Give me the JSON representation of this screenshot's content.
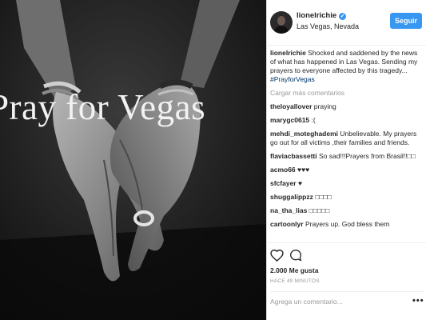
{
  "post": {
    "photo_caption": "Pray for Vegas",
    "username": "lionelrichie",
    "verified_mark": "✓",
    "location": "Las Vegas, Nevada",
    "follow_label": "Seguir",
    "caption_user": "lionelrichie",
    "caption_text": " Shocked and saddened by the news of what has happened in Las Vegas. Sending my prayers to everyone affected by this tragedy... ",
    "caption_hashtag": "#PrayforVegas",
    "load_more": "Cargar más comentarios",
    "comments": [
      {
        "user": "theloyallover",
        "text": " praying"
      },
      {
        "user": "marygc0615",
        "text": " :("
      },
      {
        "user": "mehdi_moteghademi",
        "text": " Unbelievable. My prayers go out for all victims ,their families and friends."
      },
      {
        "user": "flaviacbassetti",
        "text": " So sad!!!Prayers from Brasil!!□□"
      },
      {
        "user": "acmo66",
        "text": " ♥♥♥"
      },
      {
        "user": "sfcfayer",
        "text": " ♥"
      },
      {
        "user": "shuggalippzz",
        "text": " □□□□"
      },
      {
        "user": "na_tha_lias",
        "text": " □□□□□"
      },
      {
        "user": "cartoonlyr",
        "text": " Prayers up. God bless them"
      }
    ],
    "likes": "2.000 Me gusta",
    "time_ago": "HACE 49 MINUTOS",
    "comment_placeholder": "Agrega un comentario...",
    "more_label": "•••",
    "icons": {
      "like": "heart-icon",
      "comment": "comment-bubble-icon",
      "options": "more-options-icon"
    },
    "colors": {
      "accent": "#3897f0",
      "hashtag": "#003569",
      "muted": "#999999"
    }
  }
}
